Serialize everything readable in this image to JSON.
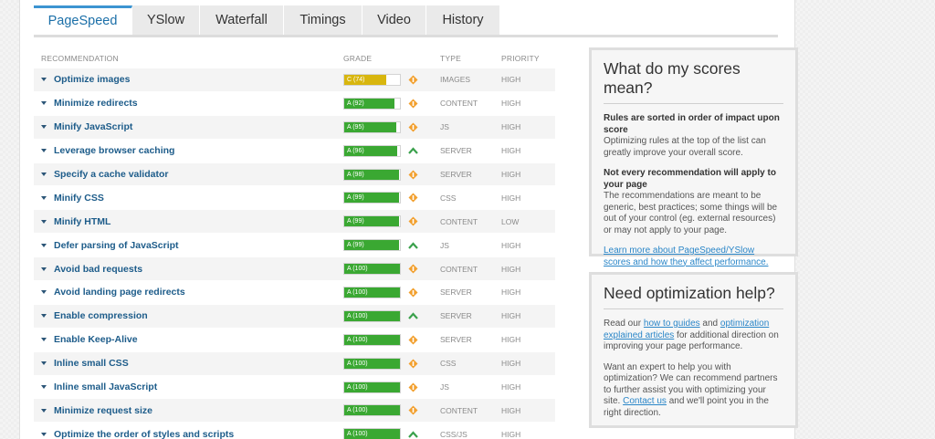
{
  "tabs": [
    "PageSpeed",
    "YSlow",
    "Waterfall",
    "Timings",
    "Video",
    "History"
  ],
  "table": {
    "headers": {
      "recommendation": "RECOMMENDATION",
      "grade": "GRADE",
      "type": "TYPE",
      "priority": "PRIORITY"
    },
    "rows": [
      {
        "name": "Optimize images",
        "grade": "C (74)",
        "score": 74,
        "trend": "diamond",
        "type": "IMAGES",
        "priority": "HIGH"
      },
      {
        "name": "Minimize redirects",
        "grade": "A (92)",
        "score": 92,
        "trend": "diamond",
        "type": "CONTENT",
        "priority": "HIGH"
      },
      {
        "name": "Minify JavaScript",
        "grade": "A (95)",
        "score": 95,
        "trend": "diamond",
        "type": "JS",
        "priority": "HIGH"
      },
      {
        "name": "Leverage browser caching",
        "grade": "A (96)",
        "score": 96,
        "trend": "up",
        "type": "SERVER",
        "priority": "HIGH"
      },
      {
        "name": "Specify a cache validator",
        "grade": "A (98)",
        "score": 98,
        "trend": "diamond",
        "type": "SERVER",
        "priority": "HIGH"
      },
      {
        "name": "Minify CSS",
        "grade": "A (99)",
        "score": 99,
        "trend": "diamond",
        "type": "CSS",
        "priority": "HIGH"
      },
      {
        "name": "Minify HTML",
        "grade": "A (99)",
        "score": 99,
        "trend": "diamond",
        "type": "CONTENT",
        "priority": "LOW"
      },
      {
        "name": "Defer parsing of JavaScript",
        "grade": "A (99)",
        "score": 99,
        "trend": "up",
        "type": "JS",
        "priority": "HIGH"
      },
      {
        "name": "Avoid bad requests",
        "grade": "A (100)",
        "score": 100,
        "trend": "diamond",
        "type": "CONTENT",
        "priority": "HIGH"
      },
      {
        "name": "Avoid landing page redirects",
        "grade": "A (100)",
        "score": 100,
        "trend": "diamond",
        "type": "SERVER",
        "priority": "HIGH"
      },
      {
        "name": "Enable compression",
        "grade": "A (100)",
        "score": 100,
        "trend": "up",
        "type": "SERVER",
        "priority": "HIGH"
      },
      {
        "name": "Enable Keep-Alive",
        "grade": "A (100)",
        "score": 100,
        "trend": "diamond",
        "type": "SERVER",
        "priority": "HIGH"
      },
      {
        "name": "Inline small CSS",
        "grade": "A (100)",
        "score": 100,
        "trend": "diamond",
        "type": "CSS",
        "priority": "HIGH"
      },
      {
        "name": "Inline small JavaScript",
        "grade": "A (100)",
        "score": 100,
        "trend": "diamond",
        "type": "JS",
        "priority": "HIGH"
      },
      {
        "name": "Minimize request size",
        "grade": "A (100)",
        "score": 100,
        "trend": "diamond",
        "type": "CONTENT",
        "priority": "HIGH"
      },
      {
        "name": "Optimize the order of styles and scripts",
        "grade": "A (100)",
        "score": 100,
        "trend": "up",
        "type": "CSS/JS",
        "priority": "HIGH"
      }
    ]
  },
  "colors": {
    "grade_a": "#3aa832",
    "grade_c": "#d8b60e",
    "diamond": "#f2a02e",
    "up": "#3aa14c",
    "link": "#2a86c8",
    "tab_active": "#1b6fa8"
  },
  "scores_box": {
    "title": "What do my scores mean?",
    "p1_bold": "Rules are sorted in order of impact upon score",
    "p1_text": "Optimizing rules at the top of the list can greatly improve your overall score.",
    "p2_bold": "Not every recommendation will apply to your page",
    "p2_text": "The recommendations are meant to be generic, best practices; some things will be out of your control (eg. external resources) or may not apply to your page.",
    "link": "Learn more about PageSpeed/YSlow scores and how they affect performance."
  },
  "help_box": {
    "title": "Need optimization help?",
    "p1_a": "Read our ",
    "p1_link1": "how to guides",
    "p1_b": " and ",
    "p1_link2": "optimization explained articles",
    "p1_c": " for additional direction on improving your page performance.",
    "p2_a": "Want an expert to help you with optimization? We can recommend partners to further assist you with optimizing your site. ",
    "p2_link": "Contact us",
    "p2_b": " and we'll point you in the right direction."
  }
}
